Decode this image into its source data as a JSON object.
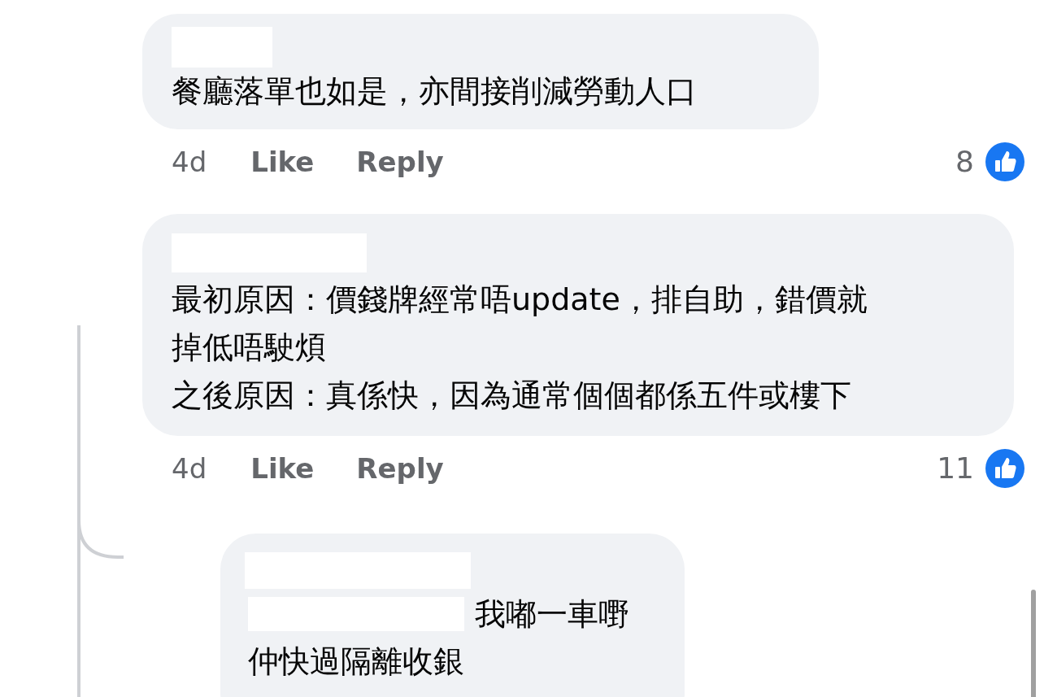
{
  "comments": [
    {
      "text_lines": [
        "餐廳落單也如是，亦間接削減勞動人口"
      ],
      "time": "4d",
      "like": "Like",
      "reply": "Reply",
      "reaction_count": "8"
    },
    {
      "text_lines": [
        "最初原因：價錢牌經常唔update，排自助，錯價就",
        "掉低唔駛煩",
        "之後原因：真係快，因為通常個個都係五件或樓下"
      ],
      "time": "4d",
      "like": "Like",
      "reply": "Reply",
      "reaction_count": "11"
    }
  ],
  "reply": {
    "text_lines": [
      "我嘟一車嘢",
      "仲快過隔離收銀"
    ]
  }
}
